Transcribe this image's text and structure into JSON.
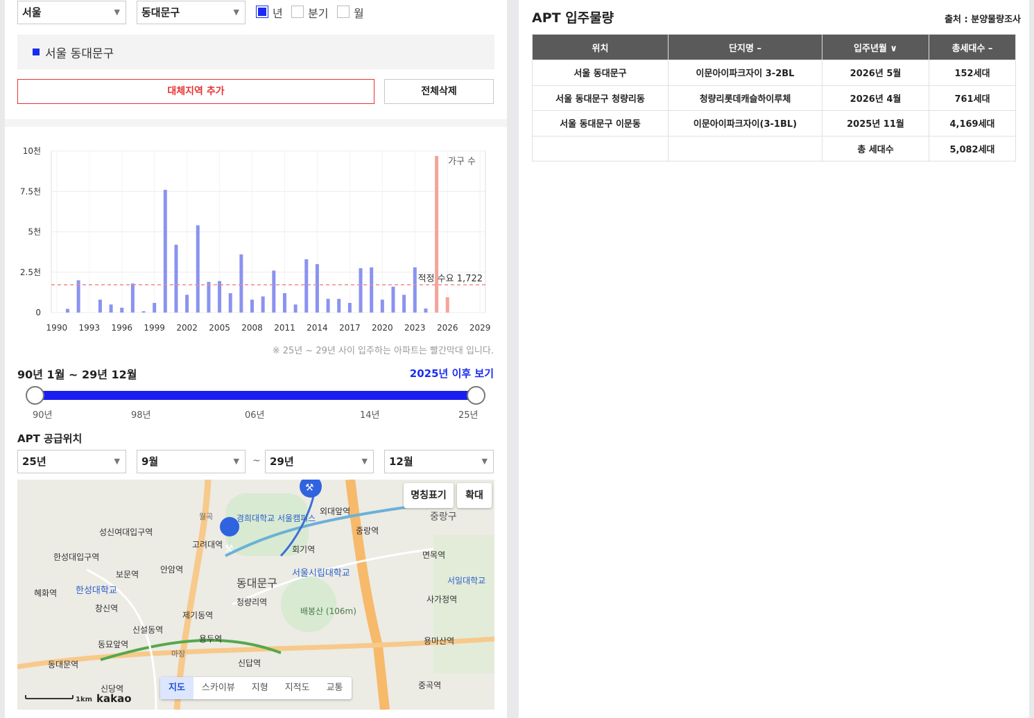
{
  "filters": {
    "city": "서울",
    "district": "동대문구",
    "period_options": [
      {
        "label": "년",
        "checked": true
      },
      {
        "label": "분기",
        "checked": false
      },
      {
        "label": "월",
        "checked": false
      }
    ]
  },
  "selected_region": "서울 동대문구",
  "buttons": {
    "add_region": "대체지역 추가",
    "delete_all": "전체삭제"
  },
  "chart_data": {
    "type": "bar",
    "legend": "가구 수",
    "y_ticks": [
      "10천",
      "7.5천",
      "5천",
      "2.5천",
      "0"
    ],
    "ylim": [
      0,
      10000
    ],
    "x_ticks": [
      "1990",
      "1993",
      "1996",
      "1999",
      "2002",
      "2005",
      "2008",
      "2011",
      "2014",
      "2017",
      "2020",
      "2023",
      "2026",
      "2029"
    ],
    "xlim": [
      1989.5,
      2029.5
    ],
    "reference_line": {
      "label": "적정 수요 1,722",
      "value": 1722
    },
    "series": [
      {
        "color": "#8a93ee",
        "x": [
          1990,
          1991,
          1992,
          1993,
          1994,
          1995,
          1996,
          1997,
          1998,
          1999,
          2000,
          2001,
          2002,
          2003,
          2004,
          2005,
          2006,
          2007,
          2008,
          2009,
          2010,
          2011,
          2012,
          2013,
          2014,
          2015,
          2016,
          2017,
          2018,
          2019,
          2020,
          2021,
          2022,
          2023,
          2024
        ],
        "values": [
          0,
          230,
          2000,
          0,
          800,
          500,
          300,
          1800,
          80,
          600,
          7600,
          4200,
          1100,
          5400,
          1900,
          1950,
          1200,
          3600,
          800,
          1000,
          2600,
          1200,
          500,
          3300,
          3000,
          850,
          850,
          600,
          2750,
          2800,
          800,
          1600,
          1100,
          2800,
          250
        ]
      },
      {
        "color": "#f4a49b",
        "x": [
          2025,
          2026
        ],
        "values": [
          9700,
          950
        ]
      }
    ],
    "note": "※ 25년 ~ 29년 사이 입주하는 아파트는 빨간막대 입니다."
  },
  "range": {
    "label": "90년 1월 ~ 29년 12월",
    "link": "2025년 이후 보기",
    "ticks": [
      "90년",
      "98년",
      "06년",
      "14년",
      "25년"
    ]
  },
  "supply_location": {
    "title": "APT 공급위치",
    "from_year": "25년",
    "from_month": "9월",
    "tilde": "~",
    "to_year": "29년",
    "to_month": "12월"
  },
  "map": {
    "buttons": {
      "names": "명칭표기",
      "zoom": "확대"
    },
    "tabs": [
      "지도",
      "스카이뷰",
      "지형",
      "지적도",
      "교통"
    ],
    "scale": "1km",
    "brand": "kakao",
    "labels": [
      "성신여대입구역",
      "고려대역",
      "경희대학교 서울캠퍼스",
      "외대앞역",
      "중랑역",
      "중랑구",
      "회기역",
      "한성대입구역",
      "보문역",
      "안암역",
      "동대문구",
      "서울시립대학교",
      "면목역",
      "서일대학교",
      "혜화역",
      "한성대학교",
      "창신역",
      "청량리역",
      "배봉산 (106m)",
      "사가정역",
      "제기동역",
      "신설동역",
      "용두역",
      "동묘앞역",
      "동대문역",
      "용마산역",
      "신답역",
      "신당역",
      "중곡역",
      "마장",
      "월곡"
    ]
  },
  "right": {
    "title": "APT 입주물량",
    "source": "출처 : 분양물량조사",
    "columns": [
      "위치",
      "단지명 –",
      "입주년월 ∨",
      "총세대수 –"
    ],
    "rows": [
      [
        "서울 동대문구",
        "이문아이파크자이 3-2BL",
        "2026년 5월",
        "152세대"
      ],
      [
        "서울 동대문구 청량리동",
        "청량리롯데캐슬하이루체",
        "2026년 4월",
        "761세대"
      ],
      [
        "서울 동대문구 이문동",
        "이문아이파크자이(3-1BL)",
        "2025년 11월",
        "4,169세대"
      ]
    ],
    "total_label": "총 세대수",
    "total_value": "5,082세대"
  }
}
